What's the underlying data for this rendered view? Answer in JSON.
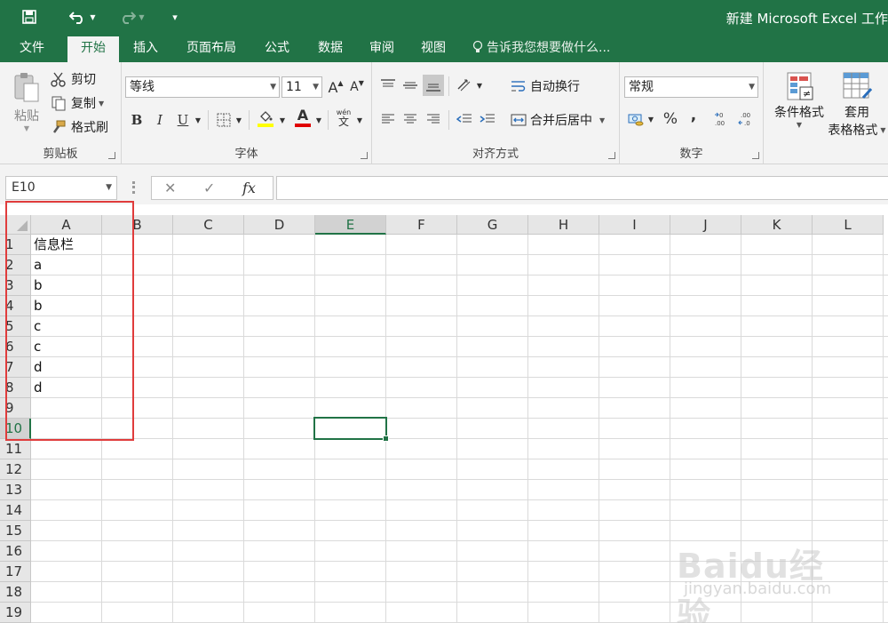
{
  "titlebar": {
    "title": "新建 Microsoft Excel 工作",
    "save_icon": "save-icon",
    "undo_icon": "undo-icon",
    "redo_icon": "redo-icon",
    "customize_icon": "customize-quick-access-icon"
  },
  "tabs": [
    "文件",
    "开始",
    "插入",
    "页面布局",
    "公式",
    "数据",
    "审阅",
    "视图"
  ],
  "active_tab": "开始",
  "tell_me": "告诉我您想要做什么...",
  "ribbon": {
    "clipboard": {
      "paste": "粘贴",
      "cut": "剪切",
      "copy": "复制",
      "format_painter": "格式刷",
      "label": "剪贴板"
    },
    "font": {
      "font_name": "等线",
      "font_size": "11",
      "grow": "A",
      "shrink": "A",
      "bold": "B",
      "italic": "I",
      "underline": "U",
      "font_color_glyph": "A",
      "phonetic_top": "wén",
      "phonetic_bottom": "文",
      "label": "字体",
      "fill_color": "#ffff00",
      "font_color": "#e00000"
    },
    "alignment": {
      "wrap_text": "自动换行",
      "merge_center": "合并后居中",
      "label": "对齐方式"
    },
    "number": {
      "format": "常规",
      "percent": "%",
      "comma": ",",
      "label": "数字"
    },
    "styles": {
      "conditional_formatting": "条件格式",
      "format_as_table_line1": "套用",
      "format_as_table_line2": "表格格式"
    }
  },
  "formula_bar": {
    "name_box": "E10",
    "cancel": "✕",
    "enter": "✓",
    "fx": "fx",
    "content": ""
  },
  "sheet": {
    "columns": [
      "A",
      "B",
      "C",
      "D",
      "E",
      "F",
      "G",
      "H",
      "I",
      "J",
      "K",
      "L"
    ],
    "rows": [
      "1",
      "2",
      "3",
      "4",
      "5",
      "6",
      "7",
      "8",
      "9",
      "10",
      "11",
      "12",
      "13",
      "14",
      "15",
      "16",
      "17",
      "18",
      "19"
    ],
    "selected_column": "E",
    "selected_row": "10",
    "column_a": [
      "信息栏",
      "a",
      "b",
      "b",
      "c",
      "c",
      "d",
      "d",
      "",
      ""
    ],
    "accent": "#217346",
    "highlight_color": "#e03c3c"
  },
  "watermark": {
    "main": "Baidu经验",
    "sub": "jingyan.baidu.com"
  }
}
